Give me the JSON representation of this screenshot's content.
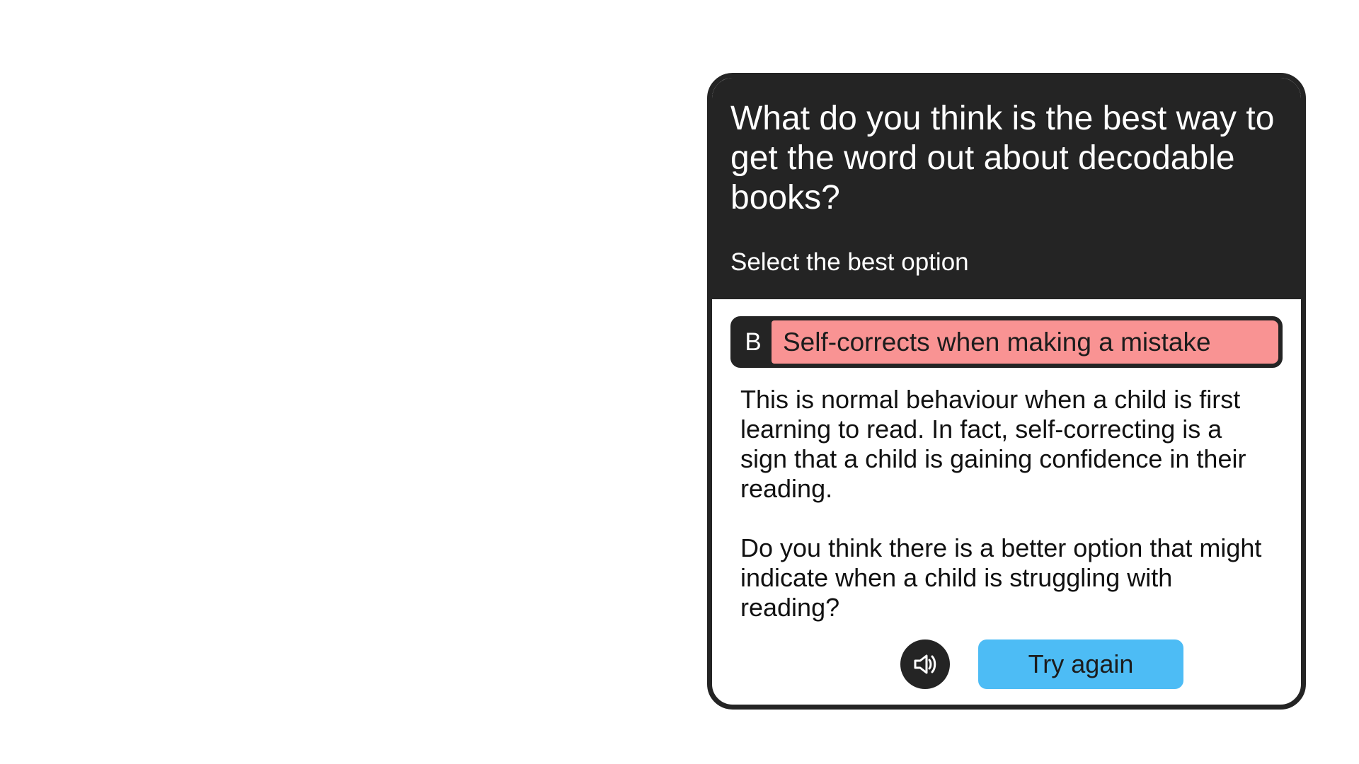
{
  "question": {
    "text": "What do you think is the best way to get the word out about decodable books?",
    "instruction": "Select the best option"
  },
  "selected_answer": {
    "letter": "B",
    "text": "Self-corrects when making a mistake",
    "status_color": "#f99393"
  },
  "feedback": {
    "paragraph_1": "This is normal behaviour when a child is first learning to read. In fact, self-correcting is a sign that a child is gaining confidence in their reading.",
    "paragraph_2": "Do you think there is a better option that might indicate when a child is struggling with reading?"
  },
  "actions": {
    "audio_icon": "speaker-icon",
    "try_again_label": "Try again",
    "try_again_color": "#4dbcf5"
  },
  "colors": {
    "card_dark": "#242424",
    "background": "#ffffff"
  }
}
